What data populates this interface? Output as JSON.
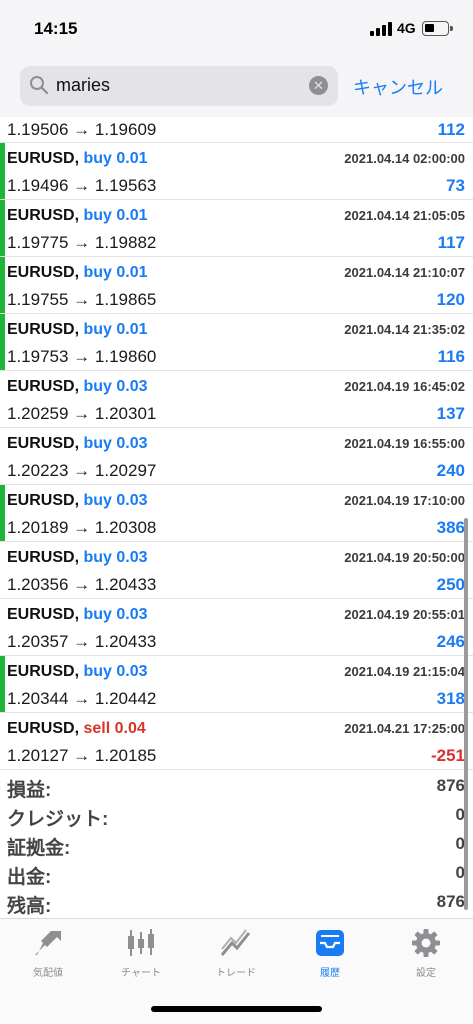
{
  "status": {
    "time": "14:15",
    "network": "4G"
  },
  "search": {
    "query": "maries",
    "cancel_label": "キャンセル"
  },
  "partial_row": {
    "prices": "1.19506 → 1.19609",
    "profit": "112"
  },
  "trades": [
    {
      "symbol": "EURUSD,",
      "side": "buy",
      "volume": "0.01",
      "datetime": "2021.04.14 02:00:00",
      "prices": "1.19496 → 1.19563",
      "profit": "73",
      "marker": true
    },
    {
      "symbol": "EURUSD,",
      "side": "buy",
      "volume": "0.01",
      "datetime": "2021.04.14 21:05:05",
      "prices": "1.19775 → 1.19882",
      "profit": "117",
      "marker": true
    },
    {
      "symbol": "EURUSD,",
      "side": "buy",
      "volume": "0.01",
      "datetime": "2021.04.14 21:10:07",
      "prices": "1.19755 → 1.19865",
      "profit": "120",
      "marker": true
    },
    {
      "symbol": "EURUSD,",
      "side": "buy",
      "volume": "0.01",
      "datetime": "2021.04.14 21:35:02",
      "prices": "1.19753 → 1.19860",
      "profit": "116",
      "marker": true
    },
    {
      "symbol": "EURUSD,",
      "side": "buy",
      "volume": "0.03",
      "datetime": "2021.04.19 16:45:02",
      "prices": "1.20259 → 1.20301",
      "profit": "137",
      "marker": false
    },
    {
      "symbol": "EURUSD,",
      "side": "buy",
      "volume": "0.03",
      "datetime": "2021.04.19 16:55:00",
      "prices": "1.20223 → 1.20297",
      "profit": "240",
      "marker": false
    },
    {
      "symbol": "EURUSD,",
      "side": "buy",
      "volume": "0.03",
      "datetime": "2021.04.19 17:10:00",
      "prices": "1.20189 → 1.20308",
      "profit": "386",
      "marker": true
    },
    {
      "symbol": "EURUSD,",
      "side": "buy",
      "volume": "0.03",
      "datetime": "2021.04.19 20:50:00",
      "prices": "1.20356 → 1.20433",
      "profit": "250",
      "marker": false
    },
    {
      "symbol": "EURUSD,",
      "side": "buy",
      "volume": "0.03",
      "datetime": "2021.04.19 20:55:01",
      "prices": "1.20357 → 1.20433",
      "profit": "246",
      "marker": false
    },
    {
      "symbol": "EURUSD,",
      "side": "buy",
      "volume": "0.03",
      "datetime": "2021.04.19 21:15:04",
      "prices": "1.20344 → 1.20442",
      "profit": "318",
      "marker": true
    },
    {
      "symbol": "EURUSD,",
      "side": "sell",
      "volume": "0.04",
      "datetime": "2021.04.21 17:25:00",
      "prices": "1.20127 → 1.20185",
      "profit": "-251",
      "marker": false
    }
  ],
  "summary": [
    {
      "label": "損益:",
      "value": "876"
    },
    {
      "label": "クレジット:",
      "value": "0"
    },
    {
      "label": "証拠金:",
      "value": "0"
    },
    {
      "label": "出金:",
      "value": "0"
    },
    {
      "label": "残高:",
      "value": "876"
    }
  ],
  "tabs": [
    {
      "label": "気配値",
      "icon": "quotes-icon",
      "active": false
    },
    {
      "label": "チャート",
      "icon": "chart-icon",
      "active": false
    },
    {
      "label": "トレード",
      "icon": "trade-icon",
      "active": false
    },
    {
      "label": "履歴",
      "icon": "history-icon",
      "active": true
    },
    {
      "label": "設定",
      "icon": "settings-icon",
      "active": false
    }
  ],
  "colors": {
    "accent": "#1a7cf5",
    "sell": "#d9332b",
    "marker": "#1fb53b"
  }
}
